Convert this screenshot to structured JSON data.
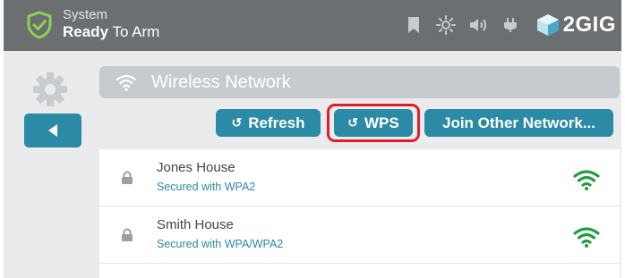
{
  "status": {
    "line1": "System",
    "line2_bold": "Ready",
    "line2_rest": " To Arm"
  },
  "topbar": {
    "icons": [
      "bookmark-icon",
      "brightness-icon",
      "volume-icon",
      "power-plug-icon"
    ],
    "brand": "2GIG"
  },
  "header": {
    "title": "Wireless Network",
    "icon": "wifi-icon"
  },
  "buttons": {
    "refresh": "Refresh",
    "wps": "WPS",
    "join": "Join Other Network..."
  },
  "networks": [
    {
      "name": "Jones House",
      "security": "Secured with WPA2"
    },
    {
      "name": "Smith House",
      "security": "Secured with WPA/WPA2"
    }
  ],
  "colors": {
    "accent": "#2b8aa6",
    "topbar": "#6b6f72",
    "highlight": "#e11d2a",
    "signal": "#1e9e3a"
  }
}
